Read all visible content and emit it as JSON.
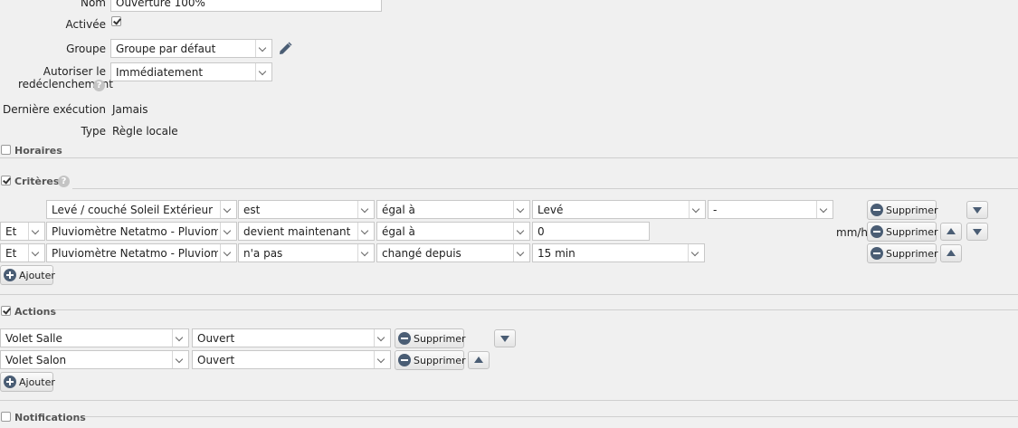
{
  "form": {
    "nom_label": "Nom",
    "nom_value": "Ouverture 100%",
    "activee_label": "Activée",
    "groupe_label": "Groupe",
    "groupe_value": "Groupe par défaut",
    "autoriser_label_line1": "Autoriser le",
    "autoriser_label_line2": "redéclenchement",
    "autoriser_value": "Immédiatement",
    "derniere_label": "Dernière exécution",
    "derniere_value": "Jamais",
    "type_label": "Type",
    "type_value": "Règle locale"
  },
  "sections": {
    "horaires": "Horaires",
    "criteres": "Critères",
    "actions": "Actions",
    "notifications": "Notifications"
  },
  "criteria": [
    {
      "conj": "",
      "device": "Levé / couché Soleil Extérieur",
      "verb": "est",
      "op": "égal à",
      "value": "Levé",
      "extra": "-",
      "unit": ""
    },
    {
      "conj": "Et",
      "device": "Pluviomètre Netatmo - Pluviometrie",
      "verb": "devient maintenant",
      "op": "égal à",
      "value": "0",
      "extra": "",
      "unit": "mm/h"
    },
    {
      "conj": "Et",
      "device": "Pluviomètre Netatmo - Pluviometrie",
      "verb": "n'a pas",
      "op": "changé depuis",
      "value": "15 min",
      "extra": "",
      "unit": ""
    }
  ],
  "actions": [
    {
      "device": "Volet Salle",
      "state": "Ouvert"
    },
    {
      "device": "Volet Salon",
      "state": "Ouvert"
    }
  ],
  "buttons": {
    "supprimer": "Supprimer",
    "ajouter": "Ajouter"
  },
  "icons": {
    "help": "?",
    "edit": "pencil-icon"
  },
  "colors": {
    "icon_blue": "#4a5d74",
    "background": "#f0f0f0"
  }
}
